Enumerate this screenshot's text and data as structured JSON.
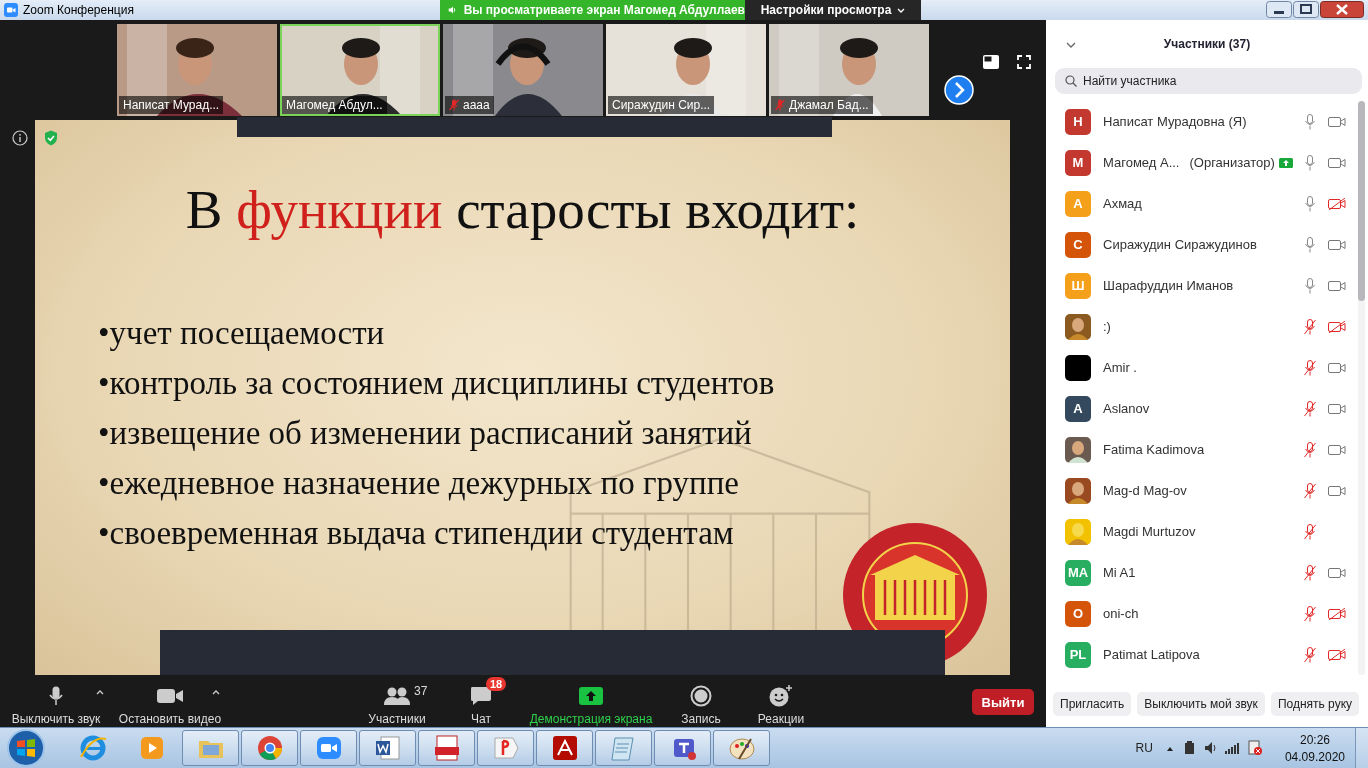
{
  "window": {
    "title": "Zoom Конференция"
  },
  "share_banner": {
    "text": "Вы просматриваете экран Магомед Абдуллаев"
  },
  "view_options": {
    "label": "Настройки просмотра"
  },
  "video_tiles": [
    {
      "name": "Написат Мурад...",
      "muted": false,
      "active": false
    },
    {
      "name": "Магомед Абдул...",
      "muted": false,
      "active": true
    },
    {
      "name": "аааа",
      "muted": true,
      "active": false
    },
    {
      "name": "Сиражудин Сир...",
      "muted": false,
      "active": false
    },
    {
      "name": "Джамал Бад...",
      "muted": true,
      "active": false
    }
  ],
  "slide": {
    "title_start": "В",
    "title_highlight": "функции",
    "title_end": "старосты входит:",
    "bullets": [
      "•учет посещаемости",
      "•контроль за состоянием дисциплины студентов",
      "•извещение об изменении расписаний занятий",
      "•ежедневное назначение дежурных по группе",
      "•своевременная выдача стипендии студентам"
    ]
  },
  "toolbar": {
    "items": [
      {
        "kind": "mic",
        "label": "Выключить звук"
      },
      {
        "kind": "video",
        "label": "Остановить видео"
      },
      {
        "kind": "participants",
        "label": "Участники",
        "count": "37"
      },
      {
        "kind": "chat",
        "label": "Чат",
        "badge": "18"
      },
      {
        "kind": "share",
        "label": "Демонстрация экрана"
      },
      {
        "kind": "record",
        "label": "Запись"
      },
      {
        "kind": "reactions",
        "label": "Реакции"
      }
    ],
    "leave": "Выйти"
  },
  "participants_panel": {
    "title": "Участники (37)",
    "search": {
      "placeholder": "Найти участника"
    },
    "participants": [
      {
        "initials": "Н",
        "color": "#c4392f",
        "name": "Написат Мурадовна (Я)",
        "mic_muted": false,
        "video_off": false
      },
      {
        "initials": "М",
        "color": "#c4392f",
        "name": "Магомед А...",
        "role": "(Организатор)",
        "sharing": true,
        "mic_muted": false,
        "video_off": false
      },
      {
        "initials": "А",
        "color": "#f5a01a",
        "name": "Ахмад",
        "mic_muted": false,
        "video_off": true
      },
      {
        "initials": "С",
        "color": "#d4550a",
        "name": "Сиражудин Сиражудинов",
        "mic_muted": false,
        "video_off": false
      },
      {
        "initials": "Ш",
        "color": "#f5a01a",
        "name": "Шарафуддин Иманов",
        "mic_muted": false,
        "video_off": false
      },
      {
        "name": ":)",
        "mic_muted": true,
        "video_off": true
      },
      {
        "name": "Amir .",
        "mic_muted": true,
        "video_off": false
      },
      {
        "initials": "A",
        "color": "#34495e",
        "name": "Aslanov",
        "mic_muted": true,
        "video_off": false
      },
      {
        "name": "Fatima Kadimova",
        "mic_muted": true,
        "video_off": false
      },
      {
        "name": "Mag-d Mag-ov",
        "mic_muted": true,
        "video_off": false
      },
      {
        "name": "Magdi Murtuzov",
        "mic_muted": true
      },
      {
        "initials": "MA",
        "color": "#27ae60",
        "name": "Mi A1",
        "mic_muted": true,
        "video_off": false
      },
      {
        "initials": "O",
        "color": "#d4550a",
        "name": "oni-ch",
        "mic_muted": true,
        "video_off": true
      },
      {
        "initials": "PL",
        "color": "#27ae60",
        "name": "Patimat Latipova",
        "mic_muted": true,
        "video_off": true
      }
    ],
    "buttons": [
      "Пригласить",
      "Выключить мой звук",
      "Поднять руку"
    ]
  },
  "taskbar": {
    "apps": [
      {
        "kind": "ie",
        "running": false
      },
      {
        "kind": "media",
        "running": false
      },
      {
        "kind": "folder",
        "running": true
      },
      {
        "kind": "chrome",
        "running": true
      },
      {
        "kind": "zoom",
        "running": true
      },
      {
        "kind": "word",
        "running": true
      },
      {
        "kind": "pdf",
        "running": true
      },
      {
        "kind": "yandex",
        "running": true
      },
      {
        "kind": "acrobat",
        "running": true
      },
      {
        "kind": "notepad",
        "running": true
      },
      {
        "kind": "teams",
        "running": true
      },
      {
        "kind": "paint",
        "running": true
      }
    ],
    "language": "RU",
    "time": "20:26",
    "date": "04.09.2020"
  }
}
